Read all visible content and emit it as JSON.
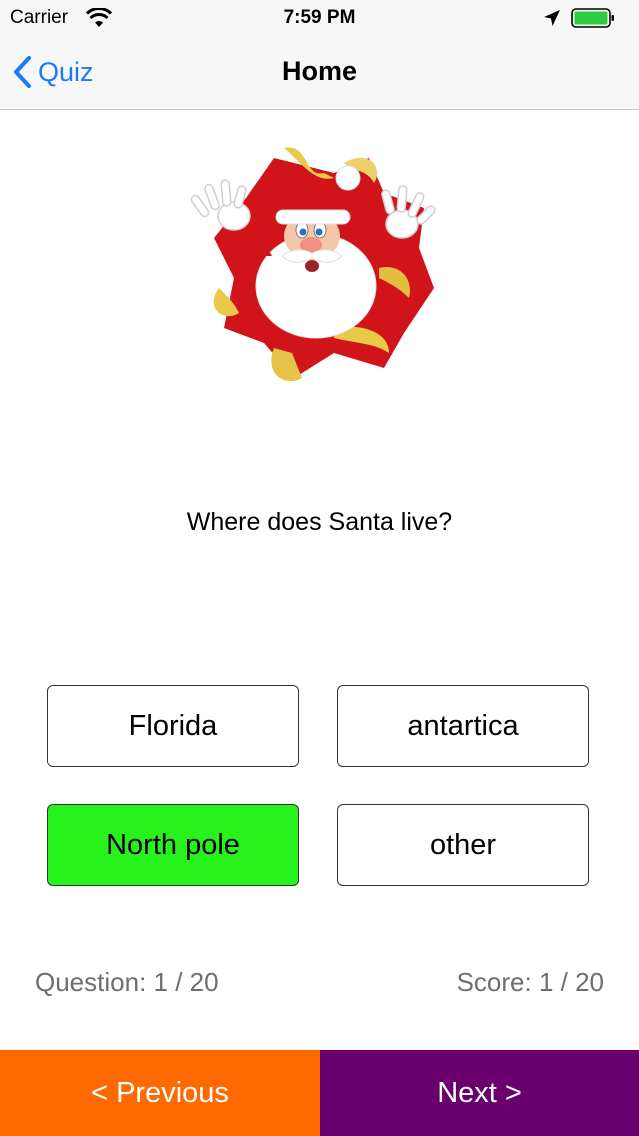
{
  "status_bar": {
    "carrier": "Carrier",
    "time": "7:59 PM",
    "battery_color": "#2ecc40"
  },
  "nav": {
    "back_label": "Quiz",
    "title": "Home",
    "accent": "#1a7cf2"
  },
  "question": {
    "text": "Where does Santa live?"
  },
  "answers": [
    {
      "label": "Florida",
      "state": "normal"
    },
    {
      "label": "antartica",
      "state": "normal"
    },
    {
      "label": "North pole",
      "state": "correct"
    },
    {
      "label": "other",
      "state": "normal"
    }
  ],
  "footer": {
    "question_progress": "Question: 1 / 20",
    "score": "Score: 1 / 20"
  },
  "buttons": {
    "previous": {
      "label": "< Previous",
      "color": "#ff6a00"
    },
    "next": {
      "label": "Next >",
      "color": "#6a006e"
    }
  },
  "icons": [
    "wifi-icon",
    "location-arrow-icon",
    "battery-icon",
    "chevron-left-icon",
    "santa-illustration"
  ]
}
